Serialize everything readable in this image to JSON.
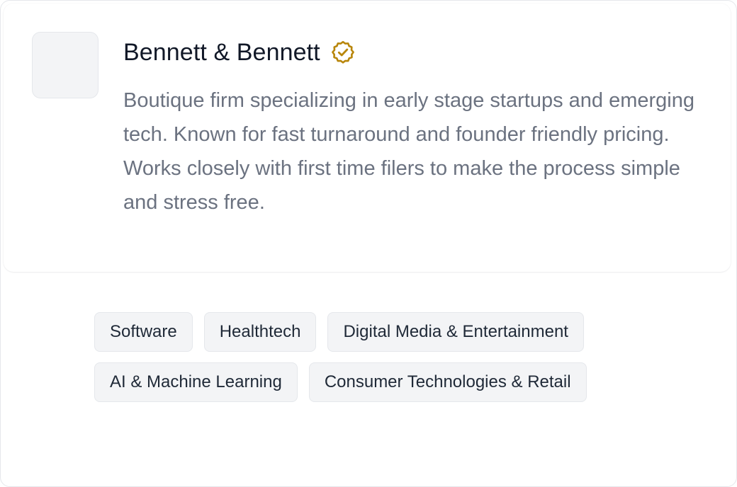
{
  "firm": {
    "name": "Bennett & Bennett",
    "verified_icon": "verified-badge-icon",
    "verified_color": "#B8860B",
    "description": "Boutique firm specializing in early stage startups and emerging tech. Known for fast turnaround and founder friendly pricing. Works closely with first time filers to make the process simple and stress free."
  },
  "tags": [
    "Software",
    "Healthtech",
    "Digital Media & Entertainment",
    "AI & Machine Learning",
    "Consumer Technologies & Retail"
  ]
}
